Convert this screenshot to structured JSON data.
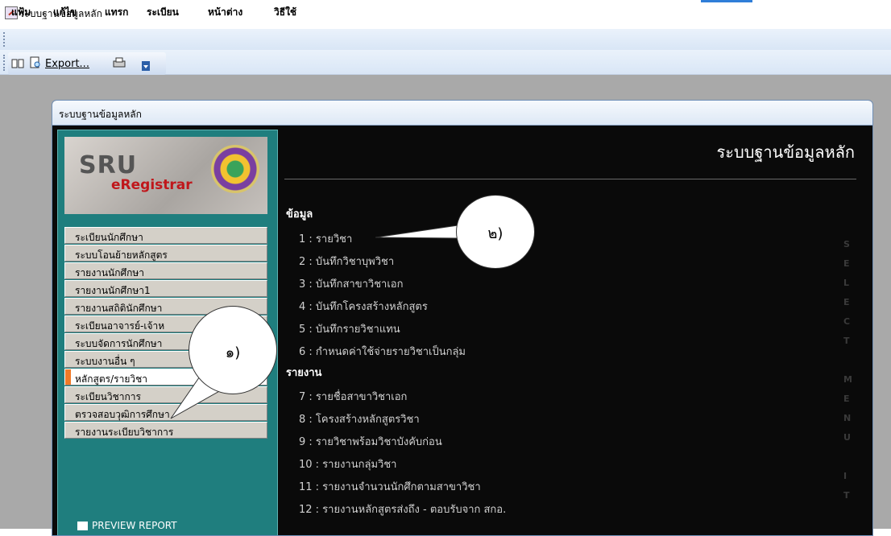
{
  "window": {
    "title": "ระบบฐานข้อมูลหลัก"
  },
  "menubar": {
    "items": [
      "แฟ้ม",
      "แก้ไข",
      "แทรก",
      "ระเบียน",
      "หน้าต่าง",
      "วิธีใช้"
    ]
  },
  "toolbar": {
    "export_label": "Export..."
  },
  "child": {
    "title": "ระบบฐานข้อมูลหลัก",
    "logo": {
      "line1": "SRU",
      "line2": "eRegistrar"
    },
    "nav": [
      "ระเบียนนักศึกษา",
      "ระบบโอนย้ายหลักสูตร",
      "รายงานนักศึกษา",
      "รายงานนักศึกษา1",
      "รายงานสถิตินักศึกษา",
      "ระเบียนอาจารย์-เจ้าห",
      "ระบบจัดการนักศึกษา",
      "ระบบงานอื่น ๆ",
      "หลักสูตร/รายวิชา",
      "ระเบียนวิชาการ",
      "ตรวจสอบวุฒิการศึกษา",
      "รายงานระเบียบวิชาการ"
    ],
    "active_nav": "หลักสูตร/รายวิชา",
    "preview_label": "PREVIEW REPORT",
    "right_title": "ระบบฐานข้อมูลหลัก",
    "sections": [
      {
        "header": "ข้อมูล",
        "items": [
          "1 : รายวิชา",
          "2 : บันทึกวิชาบุพวิชา",
          "3 : บันทึกสาขาวิชาเอก",
          "4 : บันทึกโครงสร้างหลักสูตร",
          "5 : บันทึกรายวิชาแทน",
          "6 : กำหนดค่าใช้จ่ายรายวิชาเป็นกลุ่ม"
        ]
      },
      {
        "header": "รายงาน",
        "items": [
          "7 : รายชื่อสาขาวิชาเอก",
          "8 : โครงสร้างหลักสูตรวิชา",
          "9 : รายวิชาพร้อมวิชาบังคับก่อน",
          "10 : รายงานกลุ่มวิชา",
          "11 : รายงานจำนวนนักศึกตามสาขาวิชา",
          "12 : รายงานหลักสูตรส่งถึง - ตอบรับจาก สกอ."
        ]
      }
    ],
    "vertical_text": [
      "S",
      "E",
      "L",
      "E",
      "C",
      "T",
      "M",
      "E",
      "N",
      "U",
      "I",
      "T"
    ]
  },
  "callouts": {
    "c1": "๑)",
    "c2": "๒)"
  }
}
